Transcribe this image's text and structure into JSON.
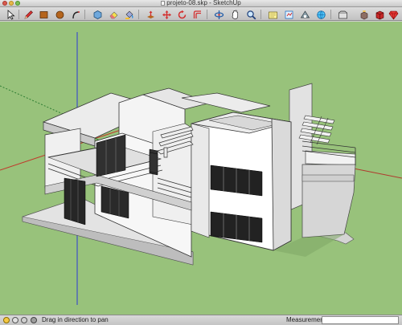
{
  "window": {
    "title": "projeto-08.skp - SketchUp"
  },
  "toolbar": {
    "tools": [
      {
        "name": "select-tool",
        "icon": "arrow-cursor-icon"
      },
      {
        "name": "pencil-tool",
        "icon": "pencil-icon"
      },
      {
        "name": "rectangle-tool",
        "icon": "rectangle-icon"
      },
      {
        "name": "circle-tool",
        "icon": "circle-icon"
      },
      {
        "name": "arc-tool",
        "icon": "arc-icon"
      },
      {
        "name": "make-component-tool",
        "icon": "component-icon"
      },
      {
        "name": "eraser-tool",
        "icon": "eraser-icon"
      },
      {
        "name": "paint-bucket-tool",
        "icon": "paint-bucket-icon"
      },
      {
        "name": "push-pull-tool",
        "icon": "push-pull-icon"
      },
      {
        "name": "move-tool",
        "icon": "move-icon"
      },
      {
        "name": "rotate-tool",
        "icon": "rotate-icon"
      },
      {
        "name": "offset-tool",
        "icon": "offset-icon"
      },
      {
        "name": "orbit-tool",
        "icon": "orbit-icon"
      },
      {
        "name": "pan-tool",
        "icon": "pan-hand-icon"
      },
      {
        "name": "zoom-tool",
        "icon": "zoom-icon"
      },
      {
        "name": "zoom-extents-tool",
        "icon": "zoom-extents-icon"
      },
      {
        "name": "previous-view-tool",
        "icon": "previous-view-icon"
      },
      {
        "name": "next-view-tool",
        "icon": "next-view-icon"
      },
      {
        "name": "get-models-tool",
        "icon": "get-models-icon"
      },
      {
        "name": "share-model-tool",
        "icon": "share-model-icon"
      },
      {
        "name": "share-component-tool",
        "icon": "share-component-icon"
      },
      {
        "name": "extension-warehouse-tool",
        "icon": "extension-icon"
      }
    ]
  },
  "viewport": {
    "ground_color": "#98c27b",
    "axis_red": "#c0392b",
    "axis_green": "#2e7d32",
    "axis_blue": "#2b3ad6"
  },
  "statusbar": {
    "hint": "Drag in direction to pan",
    "measurements_label": "Measurements",
    "measurements_value": ""
  }
}
